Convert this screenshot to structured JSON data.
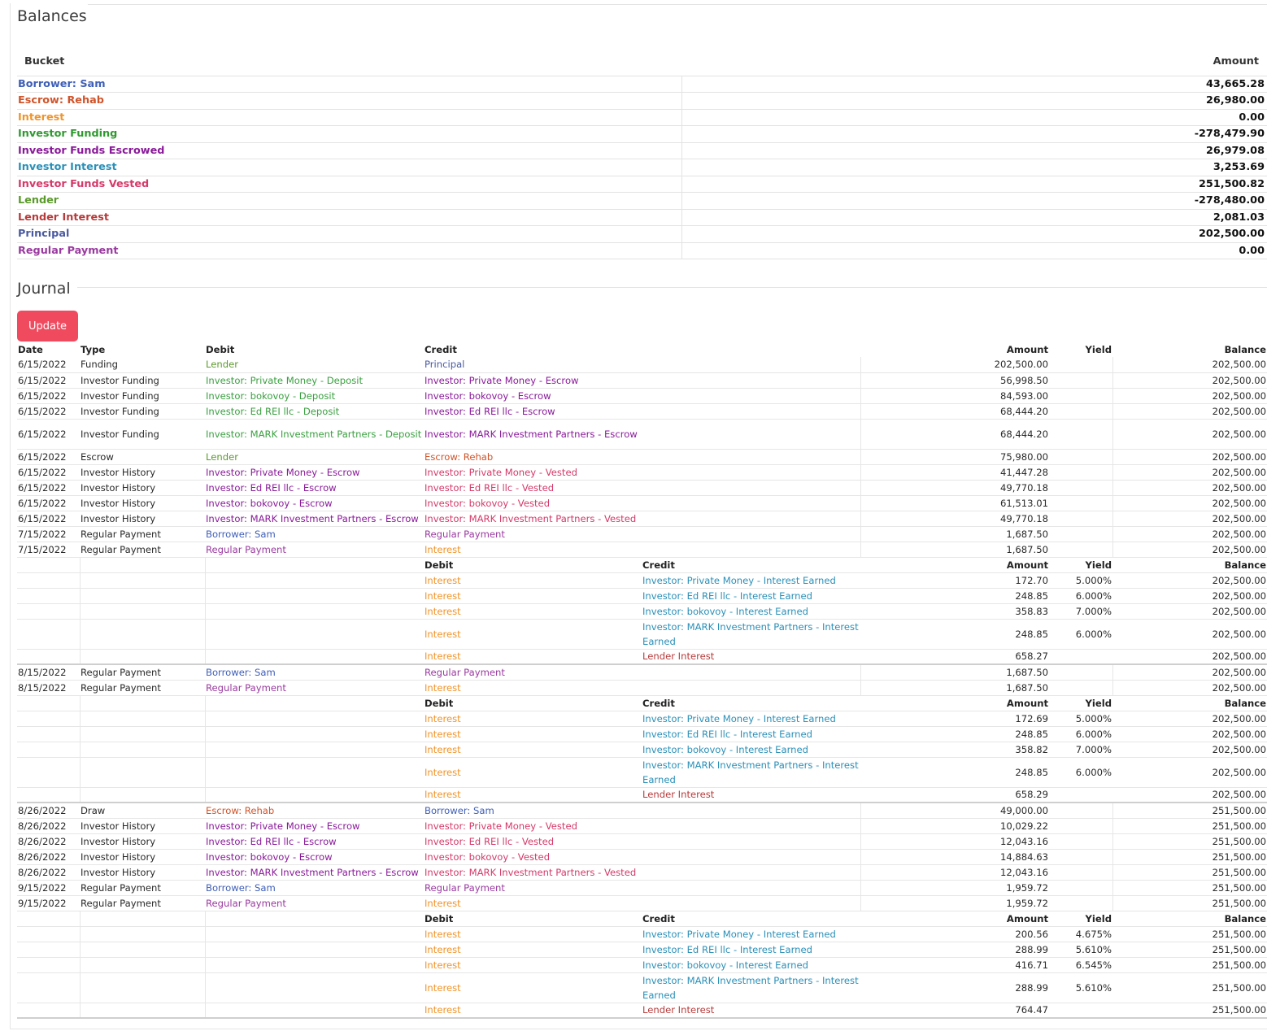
{
  "balances": {
    "title": "Balances",
    "headers": {
      "bucket": "Bucket",
      "amount": "Amount"
    },
    "rows": [
      {
        "bucket": "Borrower: Sam",
        "amount": "43,665.28",
        "color": "#4060b8"
      },
      {
        "bucket": "Escrow: Rehab",
        "amount": "26,980.00",
        "color": "#d0542a"
      },
      {
        "bucket": "Interest",
        "amount": "0.00",
        "color": "#f0942a"
      },
      {
        "bucket": "Investor Funding",
        "amount": "-278,479.90",
        "color": "#2e9a2e"
      },
      {
        "bucket": "Investor Funds Escrowed",
        "amount": "26,979.08",
        "color": "#8a1a9a"
      },
      {
        "bucket": "Investor Interest",
        "amount": "3,253.69",
        "color": "#2a90b8"
      },
      {
        "bucket": "Investor Funds Vested",
        "amount": "251,500.82",
        "color": "#d43a6a"
      },
      {
        "bucket": "Lender",
        "amount": "-278,480.00",
        "color": "#5a9a2a"
      },
      {
        "bucket": "Lender Interest",
        "amount": "2,081.03",
        "color": "#b83a3a"
      },
      {
        "bucket": "Principal",
        "amount": "202,500.00",
        "color": "#4a5aa0"
      },
      {
        "bucket": "Regular Payment",
        "amount": "0.00",
        "color": "#9a3aa0"
      }
    ]
  },
  "journal": {
    "title": "Journal",
    "update_label": "Update",
    "headers": {
      "date": "Date",
      "type": "Type",
      "debit": "Debit",
      "credit": "Credit",
      "amount": "Amount",
      "yield": "Yield",
      "balance": "Balance"
    },
    "rows": [
      {
        "date": "6/15/2022",
        "type": "Funding",
        "debit": "Lender",
        "dc": "c-lender",
        "credit": "Principal",
        "cc": "c-principal",
        "amount": "202,500.00",
        "balance": "202,500.00"
      },
      {
        "date": "6/15/2022",
        "type": "Investor Funding",
        "debit": "Investor: Private Money - Deposit",
        "dc": "c-inv-dep",
        "credit": "Investor: Private Money - Escrow",
        "cc": "c-inv-esc",
        "amount": "56,998.50",
        "balance": "202,500.00"
      },
      {
        "date": "6/15/2022",
        "type": "Investor Funding",
        "debit": "Investor: bokovoy - Deposit",
        "dc": "c-inv-dep",
        "credit": "Investor: bokovoy - Escrow",
        "cc": "c-inv-esc",
        "amount": "84,593.00",
        "balance": "202,500.00"
      },
      {
        "date": "6/15/2022",
        "type": "Investor Funding",
        "debit": "Investor: Ed REI llc - Deposit",
        "dc": "c-inv-dep",
        "credit": "Investor: Ed REI llc - Escrow",
        "cc": "c-inv-esc",
        "amount": "68,444.20",
        "balance": "202,500.00"
      },
      {
        "date": "6/15/2022",
        "type": "Investor Funding",
        "debit": "Investor: MARK Investment Partners - Deposit",
        "dc": "c-inv-dep",
        "credit": "Investor: MARK Investment Partners - Escrow",
        "cc": "c-inv-esc",
        "amount": "68,444.20",
        "balance": "202,500.00",
        "tall": true
      },
      {
        "date": "6/15/2022",
        "type": "Escrow",
        "debit": "Lender",
        "dc": "c-lender",
        "credit": "Escrow: Rehab",
        "cc": "c-escrow",
        "amount": "75,980.00",
        "balance": "202,500.00"
      },
      {
        "date": "6/15/2022",
        "type": "Investor History",
        "debit": "Investor: Private Money - Escrow",
        "dc": "c-inv-esc",
        "credit": "Investor: Private Money - Vested",
        "cc": "c-vested",
        "amount": "41,447.28",
        "balance": "202,500.00"
      },
      {
        "date": "6/15/2022",
        "type": "Investor History",
        "debit": "Investor: Ed REI llc - Escrow",
        "dc": "c-inv-esc",
        "credit": "Investor: Ed REI llc - Vested",
        "cc": "c-vested",
        "amount": "49,770.18",
        "balance": "202,500.00"
      },
      {
        "date": "6/15/2022",
        "type": "Investor History",
        "debit": "Investor: bokovoy - Escrow",
        "dc": "c-inv-esc",
        "credit": "Investor: bokovoy - Vested",
        "cc": "c-vested",
        "amount": "61,513.01",
        "balance": "202,500.00"
      },
      {
        "date": "6/15/2022",
        "type": "Investor History",
        "debit": "Investor: MARK Investment Partners - Escrow",
        "dc": "c-inv-esc",
        "credit": "Investor: MARK Investment Partners - Vested",
        "cc": "c-vested",
        "amount": "49,770.18",
        "balance": "202,500.00"
      },
      {
        "date": "7/15/2022",
        "type": "Regular Payment",
        "debit": "Borrower: Sam",
        "dc": "c-borrower",
        "credit": "Regular Payment",
        "cc": "c-regpay",
        "amount": "1,687.50",
        "balance": "202,500.00"
      },
      {
        "date": "7/15/2022",
        "type": "Regular Payment",
        "debit": "Regular Payment",
        "dc": "c-regpay",
        "credit": "Interest",
        "cc": "c-interest",
        "amount": "1,687.50",
        "balance": "202,500.00",
        "sub": [
          {
            "debit": "Interest",
            "credit": "Investor: Private Money - Interest Earned",
            "cc": "c-earned",
            "amount": "172.70",
            "yield": "5.000%",
            "balance": "202,500.00"
          },
          {
            "debit": "Interest",
            "credit": "Investor: Ed REI llc - Interest Earned",
            "cc": "c-earned",
            "amount": "248.85",
            "yield": "6.000%",
            "balance": "202,500.00"
          },
          {
            "debit": "Interest",
            "credit": "Investor: bokovoy - Interest Earned",
            "cc": "c-earned",
            "amount": "358.83",
            "yield": "7.000%",
            "balance": "202,500.00"
          },
          {
            "debit": "Interest",
            "credit": "Investor: MARK Investment Partners - Interest Earned",
            "cc": "c-earned",
            "amount": "248.85",
            "yield": "6.000%",
            "balance": "202,500.00",
            "tall": true
          },
          {
            "debit": "Interest",
            "credit": "Lender Interest",
            "cc": "c-lint",
            "amount": "658.27",
            "yield": "",
            "balance": "202,500.00"
          }
        ]
      },
      {
        "date": "8/15/2022",
        "type": "Regular Payment",
        "debit": "Borrower: Sam",
        "dc": "c-borrower",
        "credit": "Regular Payment",
        "cc": "c-regpay",
        "amount": "1,687.50",
        "balance": "202,500.00"
      },
      {
        "date": "8/15/2022",
        "type": "Regular Payment",
        "debit": "Regular Payment",
        "dc": "c-regpay",
        "credit": "Interest",
        "cc": "c-interest",
        "amount": "1,687.50",
        "balance": "202,500.00",
        "sub": [
          {
            "debit": "Interest",
            "credit": "Investor: Private Money - Interest Earned",
            "cc": "c-earned",
            "amount": "172.69",
            "yield": "5.000%",
            "balance": "202,500.00"
          },
          {
            "debit": "Interest",
            "credit": "Investor: Ed REI llc - Interest Earned",
            "cc": "c-earned",
            "amount": "248.85",
            "yield": "6.000%",
            "balance": "202,500.00"
          },
          {
            "debit": "Interest",
            "credit": "Investor: bokovoy - Interest Earned",
            "cc": "c-earned",
            "amount": "358.82",
            "yield": "7.000%",
            "balance": "202,500.00"
          },
          {
            "debit": "Interest",
            "credit": "Investor: MARK Investment Partners - Interest Earned",
            "cc": "c-earned",
            "amount": "248.85",
            "yield": "6.000%",
            "balance": "202,500.00",
            "tall": true
          },
          {
            "debit": "Interest",
            "credit": "Lender Interest",
            "cc": "c-lint",
            "amount": "658.29",
            "yield": "",
            "balance": "202,500.00"
          }
        ]
      },
      {
        "date": "8/26/2022",
        "type": "Draw",
        "debit": "Escrow: Rehab",
        "dc": "c-escrow",
        "credit": "Borrower: Sam",
        "cc": "c-borrower",
        "amount": "49,000.00",
        "balance": "251,500.00"
      },
      {
        "date": "8/26/2022",
        "type": "Investor History",
        "debit": "Investor: Private Money - Escrow",
        "dc": "c-inv-esc",
        "credit": "Investor: Private Money - Vested",
        "cc": "c-vested",
        "amount": "10,029.22",
        "balance": "251,500.00"
      },
      {
        "date": "8/26/2022",
        "type": "Investor History",
        "debit": "Investor: Ed REI llc - Escrow",
        "dc": "c-inv-esc",
        "credit": "Investor: Ed REI llc - Vested",
        "cc": "c-vested",
        "amount": "12,043.16",
        "balance": "251,500.00"
      },
      {
        "date": "8/26/2022",
        "type": "Investor History",
        "debit": "Investor: bokovoy - Escrow",
        "dc": "c-inv-esc",
        "credit": "Investor: bokovoy - Vested",
        "cc": "c-vested",
        "amount": "14,884.63",
        "balance": "251,500.00"
      },
      {
        "date": "8/26/2022",
        "type": "Investor History",
        "debit": "Investor: MARK Investment Partners - Escrow",
        "dc": "c-inv-esc",
        "credit": "Investor: MARK Investment Partners - Vested",
        "cc": "c-vested",
        "amount": "12,043.16",
        "balance": "251,500.00"
      },
      {
        "date": "9/15/2022",
        "type": "Regular Payment",
        "debit": "Borrower: Sam",
        "dc": "c-borrower",
        "credit": "Regular Payment",
        "cc": "c-regpay",
        "amount": "1,959.72",
        "balance": "251,500.00"
      },
      {
        "date": "9/15/2022",
        "type": "Regular Payment",
        "debit": "Regular Payment",
        "dc": "c-regpay",
        "credit": "Interest",
        "cc": "c-interest",
        "amount": "1,959.72",
        "balance": "251,500.00",
        "sub": [
          {
            "debit": "Interest",
            "credit": "Investor: Private Money - Interest Earned",
            "cc": "c-earned",
            "amount": "200.56",
            "yield": "4.675%",
            "balance": "251,500.00"
          },
          {
            "debit": "Interest",
            "credit": "Investor: Ed REI llc - Interest Earned",
            "cc": "c-earned",
            "amount": "288.99",
            "yield": "5.610%",
            "balance": "251,500.00"
          },
          {
            "debit": "Interest",
            "credit": "Investor: bokovoy - Interest Earned",
            "cc": "c-earned",
            "amount": "416.71",
            "yield": "6.545%",
            "balance": "251,500.00"
          },
          {
            "debit": "Interest",
            "credit": "Investor: MARK Investment Partners - Interest Earned",
            "cc": "c-earned",
            "amount": "288.99",
            "yield": "5.610%",
            "balance": "251,500.00",
            "tall": true
          },
          {
            "debit": "Interest",
            "credit": "Lender Interest",
            "cc": "c-lint",
            "amount": "764.47",
            "yield": "",
            "balance": "251,500.00"
          }
        ]
      }
    ]
  }
}
